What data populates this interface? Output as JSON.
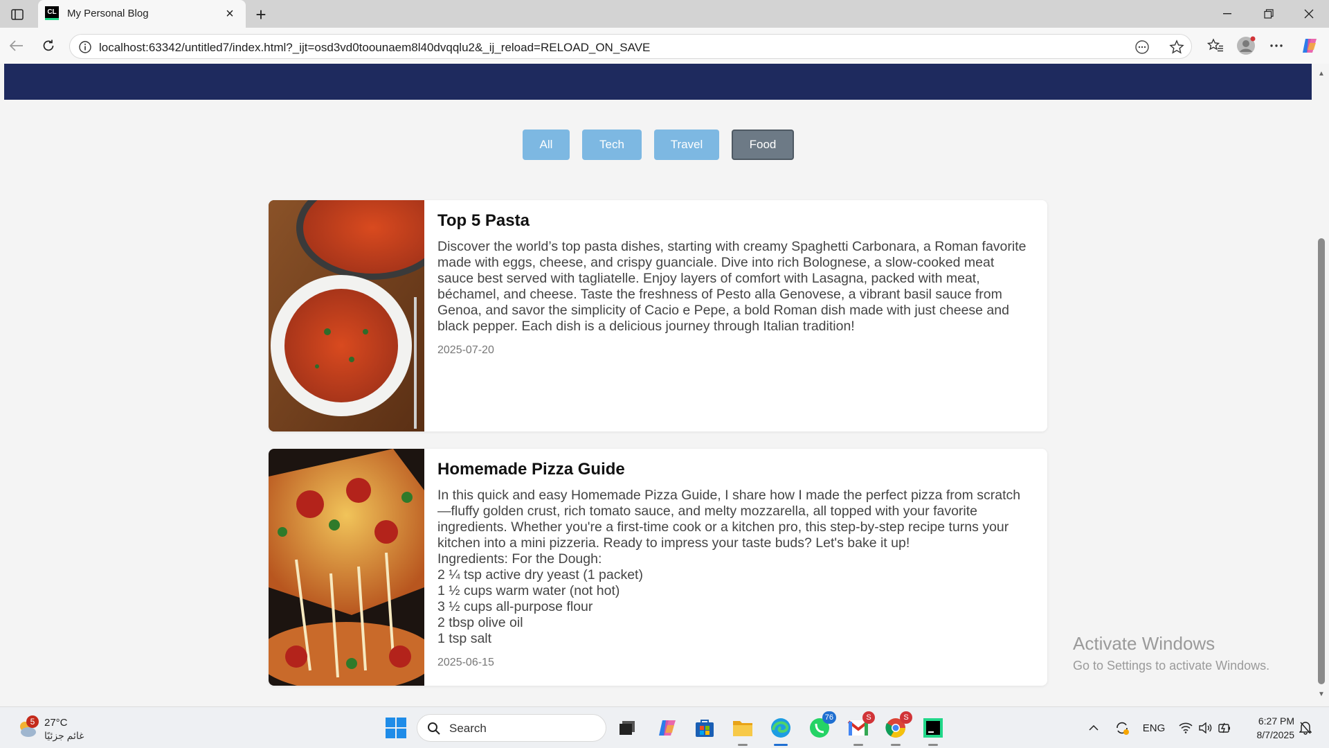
{
  "browser": {
    "tab_title": "My Personal Blog",
    "tab_favicon_text": "CL",
    "url": "localhost:63342/untitled7/index.html?_ijt=osd3vd0toounaem8l40dvqqlu2&_ij_reload=RELOAD_ON_SAVE"
  },
  "filters": [
    {
      "label": "All",
      "active": false
    },
    {
      "label": "Tech",
      "active": false
    },
    {
      "label": "Travel",
      "active": false
    },
    {
      "label": "Food",
      "active": true
    }
  ],
  "posts": [
    {
      "title": "Top 5 Pasta",
      "text": "Discover the world’s top pasta dishes, starting with creamy Spaghetti Carbonara, a Roman favorite made with eggs, cheese, and crispy guanciale. Dive into rich Bolognese, a slow-cooked meat sauce best served with tagliatelle. Enjoy layers of comfort with Lasagna, packed with meat, béchamel, and cheese. Taste the freshness of Pesto alla Genovese, a vibrant basil sauce from Genoa, and savor the simplicity of Cacio e Pepe, a bold Roman dish made with just cheese and black pepper. Each dish is a delicious journey through Italian tradition!",
      "date": "2025-07-20",
      "image": "pasta-plate"
    },
    {
      "title": "Homemade Pizza Guide",
      "text": "In this quick and easy Homemade Pizza Guide, I share how I made the perfect pizza from scratch—fluffy golden crust, rich tomato sauce, and melty mozzarella, all topped with your favorite ingredients. Whether you're a first-time cook or a kitchen pro, this step-by-step recipe turns your kitchen into a mini pizzeria. Ready to impress your taste buds? Let's bake it up!",
      "lines": [
        "Ingredients: For the Dough:",
        "2 ¼ tsp active dry yeast (1 packet)",
        "1 ½ cups warm water (not hot)",
        "3 ½ cups all-purpose flour",
        "2 tbsp olive oil",
        "1 tsp salt"
      ],
      "date": "2025-06-15",
      "image": "pizza-slice"
    }
  ],
  "watermark": {
    "line1": "Activate Windows",
    "line2": "Go to Settings to activate Windows."
  },
  "taskbar": {
    "weather_temp": "27°C",
    "weather_desc": "غائم جزئيًا",
    "weather_badge": "5",
    "search_label": "Search",
    "whatsapp_badge": "76",
    "gmail_badge": "S",
    "chrome_badge": "S",
    "language": "ENG",
    "time": "6:27 PM",
    "date": "8/7/2025"
  },
  "colors": {
    "header": "#1e2a5e",
    "filter_button": "#7db8e2",
    "filter_active": "#6d7a86"
  }
}
